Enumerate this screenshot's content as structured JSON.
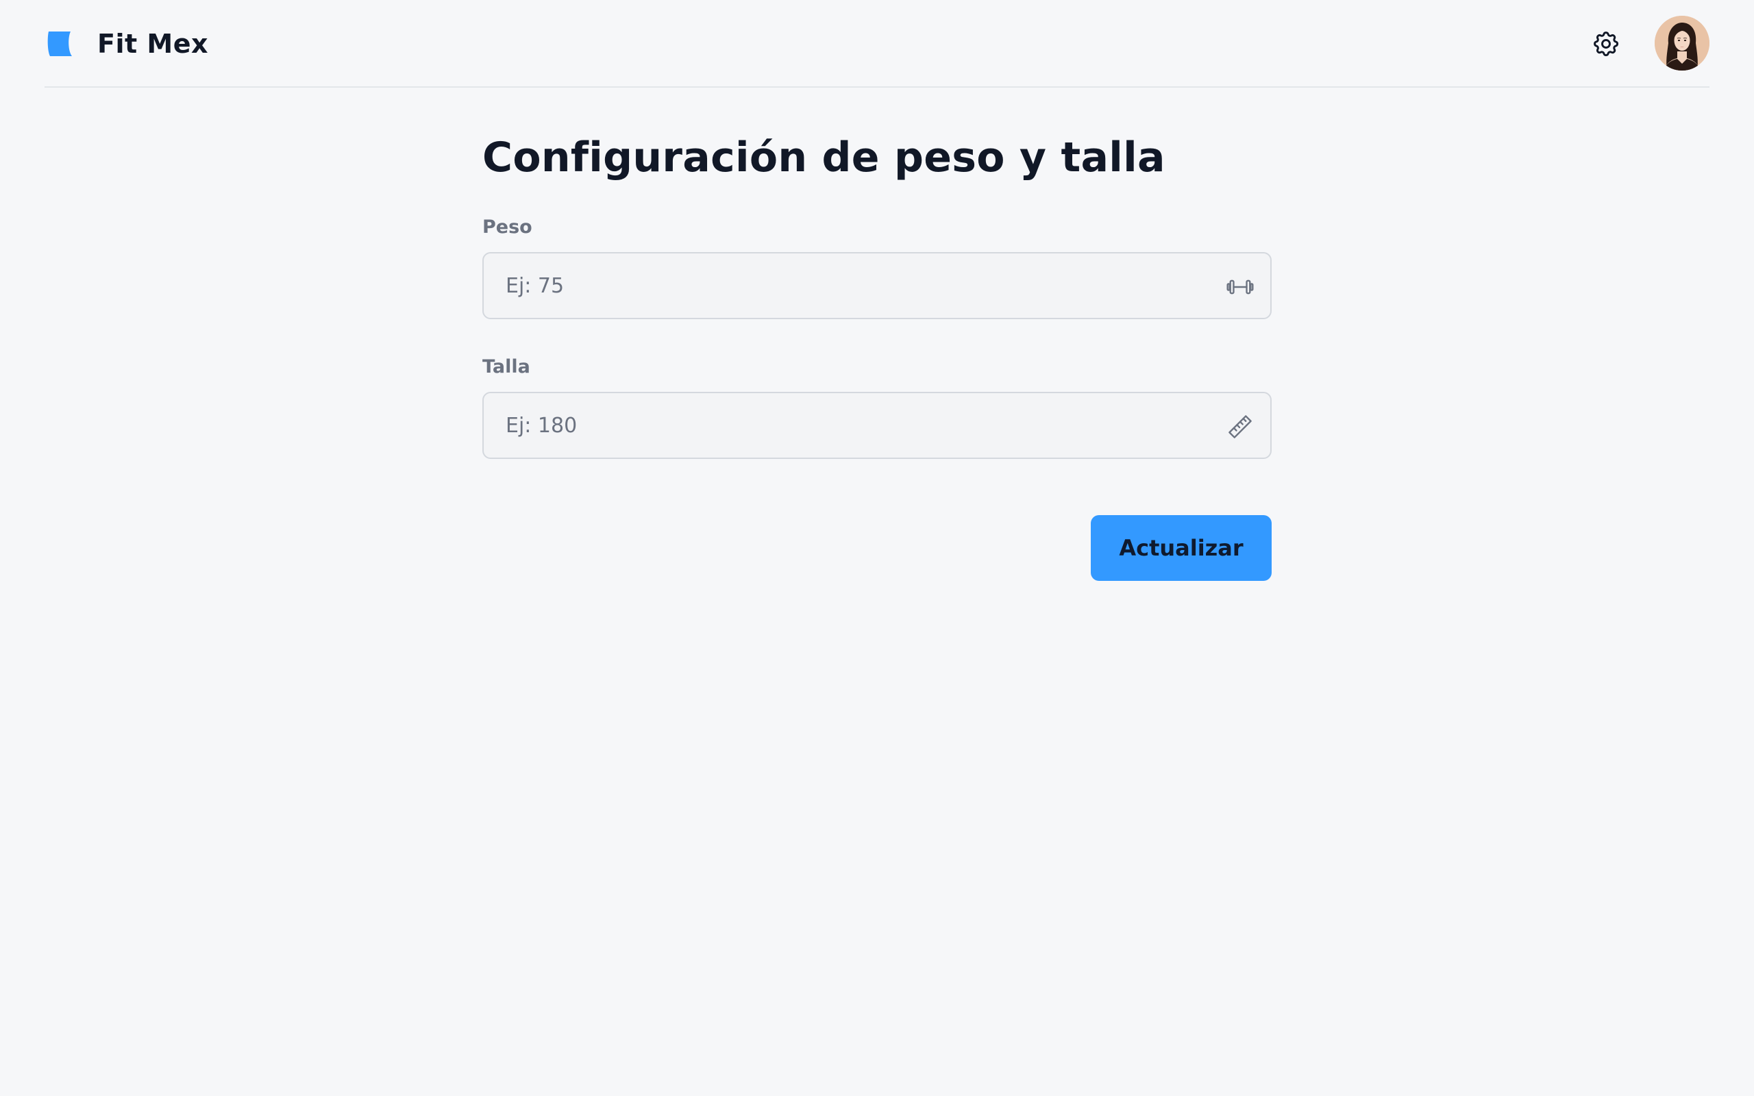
{
  "app": {
    "name": "Fit Mex",
    "logo_icon": "brand-logo-icon",
    "accent_color": "#3399ff"
  },
  "header": {
    "settings_icon": "gear-icon",
    "avatar_icon": "avatar-icon"
  },
  "page": {
    "title": "Configuración de peso y talla"
  },
  "form": {
    "peso": {
      "label": "Peso",
      "value": "",
      "placeholder": "Ej: 75",
      "icon": "dumbbell-icon"
    },
    "talla": {
      "label": "Talla",
      "value": "",
      "placeholder": "Ej: 180",
      "icon": "ruler-icon"
    },
    "submit_label": "Actualizar"
  }
}
